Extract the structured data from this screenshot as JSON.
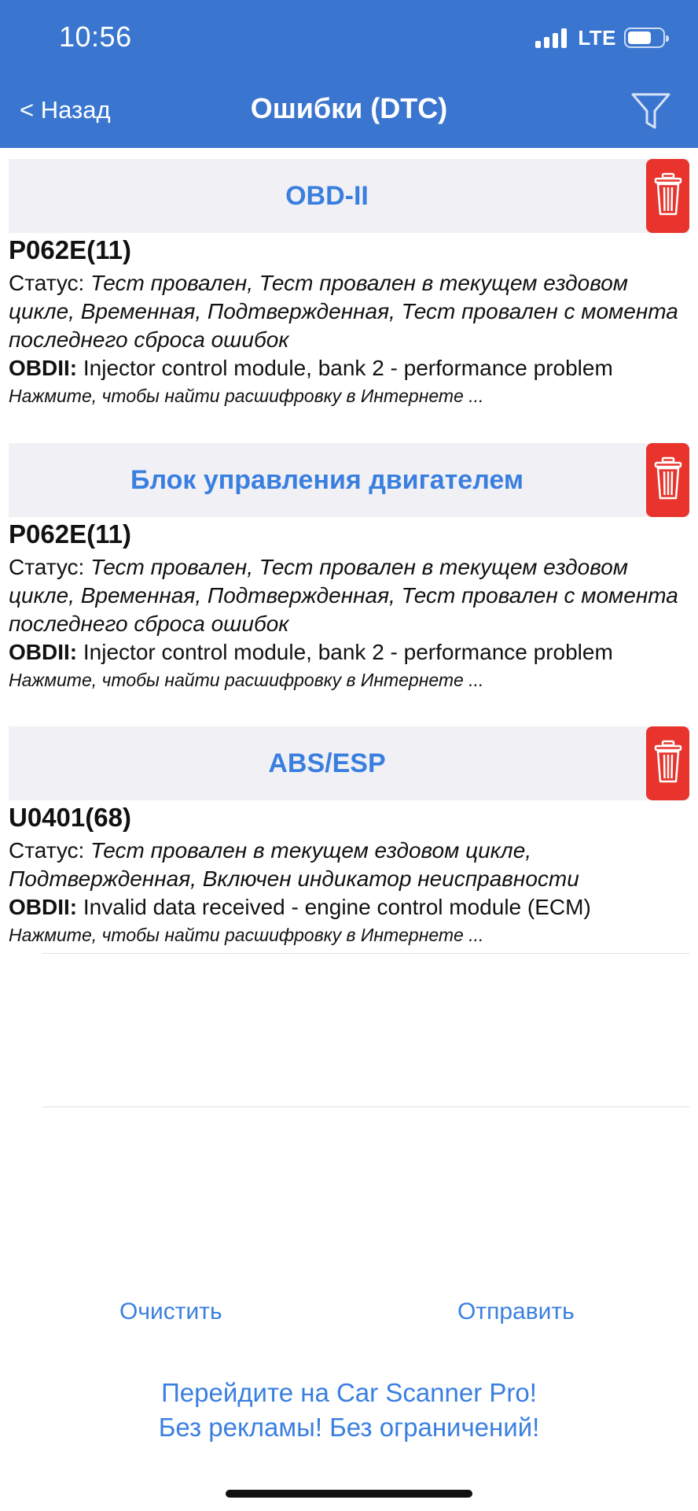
{
  "status_bar": {
    "time": "10:56",
    "network": "LTE"
  },
  "nav": {
    "back_label": "< Назад",
    "title": "Ошибки (DTC)"
  },
  "sections": [
    {
      "title": "OBD-II",
      "dtc": {
        "code": "P062E(11)",
        "status_label": "Статус:",
        "status_value": "Тест провален, Тест провален в текущем ездовом цикле, Временная, Подтвержденная, Тест провален с момента последнего сброса ошибок",
        "desc_label": "OBDII:",
        "desc_value": "Injector control module, bank 2 - performance problem",
        "hint": "Нажмите, чтобы найти расшифровку в Интернете ..."
      }
    },
    {
      "title": "Блок управления двигателем",
      "dtc": {
        "code": "P062E(11)",
        "status_label": "Статус:",
        "status_value": "Тест провален, Тест провален в текущем ездовом цикле, Временная, Подтвержденная, Тест провален с момента последнего сброса ошибок",
        "desc_label": "OBDII:",
        "desc_value": "Injector control module, bank 2 - performance problem",
        "hint": "Нажмите, чтобы найти расшифровку в Интернете ..."
      }
    },
    {
      "title": "ABS/ESP",
      "dtc": {
        "code": "U0401(68)",
        "status_label": "Статус:",
        "status_value": "Тест провален в текущем ездовом цикле, Подтвержденная, Включен индикатор неисправности",
        "desc_label": "OBDII:",
        "desc_value": "Invalid data received - engine control module (ECM)",
        "hint": "Нажмите, чтобы найти расшифровку в Интернете ..."
      }
    }
  ],
  "actions": {
    "clear_label": "Очистить",
    "send_label": "Отправить"
  },
  "promo": {
    "line1": "Перейдите на Car Scanner Pro!",
    "line2": "Без рекламы! Без ограничений!"
  },
  "colors": {
    "header_bg": "#3a76d0",
    "accent": "#3a7fe0",
    "delete": "#e8342c",
    "section_bg": "#f1f1f5"
  }
}
